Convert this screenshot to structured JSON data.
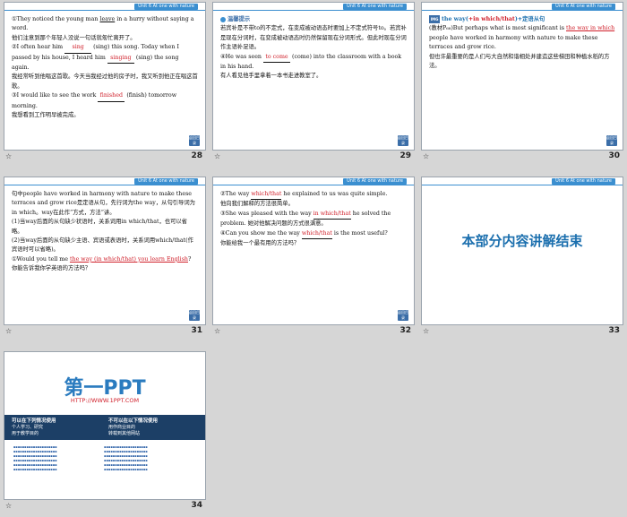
{
  "header_tag": "Unit 6   At one with nature",
  "slides": [
    {
      "num": "28",
      "lines": [
        {
          "pre": "①They noticed the young man ",
          "ul": "leave",
          "post": " in a hurry without saying a word."
        },
        {
          "zh": "他们注意到那个年轻人没说一句话就匆忙离开了。"
        },
        {
          "pre": "②I often hear him ",
          "blank": "sing",
          "post": " (sing) this song. Today when I passed by his house, I heard him ",
          "blank2": "singing",
          "post2": " (sing) the song again."
        },
        {
          "zh": "我经常听到他唱这首歌。今天当我经过他的房子时，我又听到他正在唱这首歌。"
        },
        {
          "pre": "③I would like to see the work ",
          "blank": "finished",
          "post": " (finish) tomorrow morning."
        },
        {
          "zh": "我想看到工作明早被完成。"
        }
      ]
    },
    {
      "num": "29",
      "tip_title": "温馨提示",
      "lines": [
        {
          "zh": "若宾补是不带to的不定式，在变成被动语态时要加上不定式符号to。若宾补是现在分词时，在变成被动语态时仍然保留现在分词形式。但此时现在分词作主语补足语。"
        },
        {
          "pre": "④He was seen ",
          "blank": "to come",
          "post": " (come) into the classroom with a book in his hand."
        },
        {
          "zh": "有人看见他手里拿着一本书走进教室了。"
        }
      ]
    },
    {
      "num": "30",
      "title_pre": "the way(",
      "title_red": "+in which/that",
      "title_post": ")+定语从句",
      "lines": [
        {
          "pre": "(教材P₆₈)But perhaps what is most significant is ",
          "ul": "the way in which",
          "post": " people have worked in harmony with nature to make these terraces and grow rice."
        },
        {
          "zh": "但也许最重要的是人们与大自然和谐相处并建造这些梯田和种植水稻的方法。"
        }
      ]
    },
    {
      "num": "31",
      "lines": [
        {
          "zh": "句中people have worked in harmony with nature to make these terraces and grow rice是定语从句，先行词为the way，从句引导词为in which。way在此作“方式，方法”讲。"
        },
        {
          "zh": "(1)当way后面的从句缺少状语时，关系词用in which/that，也可以省略。"
        },
        {
          "zh": "(2)当way后面的从句缺少主语、宾语或表语时，关系词用which/that(作宾语时可以省略)。"
        },
        {
          "pre": "①Would you tell me ",
          "ul": "the way (in which/that) you learn English",
          "post": "?  你能告诉我你学英语的方法吗？"
        }
      ]
    },
    {
      "num": "32",
      "lines": [
        {
          "pre": "②The way ",
          "blank": "which/that",
          "post": " he explained to us was quite simple."
        },
        {
          "zh": "他向我们解释的方法很简单。"
        },
        {
          "pre": "③She was pleased with the way ",
          "blank": "in which/that",
          "post": " he solved the problem.  她对他解决问题的方式很满意。"
        },
        {
          "pre": "④Can you show me the way ",
          "blank": "which/that",
          "post": " is the most useful?"
        },
        {
          "zh": "你能给我一个最有用的方法吗？"
        }
      ]
    },
    {
      "num": "33",
      "end_title": "本部分内容讲解结束"
    },
    {
      "num": "34",
      "logo": "第一PPT",
      "url": "HTTP://WWW.1PPT.COM",
      "can_title": "可以在下列情况使用",
      "can_items": [
        "个人学习、研究",
        "用于教学目的"
      ],
      "cannot_title": "不可以在以下情况使用",
      "cannot_items": [
        "用作商业目的",
        "转载到其他网站"
      ]
    }
  ],
  "star_glyph": "☆",
  "btn_label": "返回目录"
}
